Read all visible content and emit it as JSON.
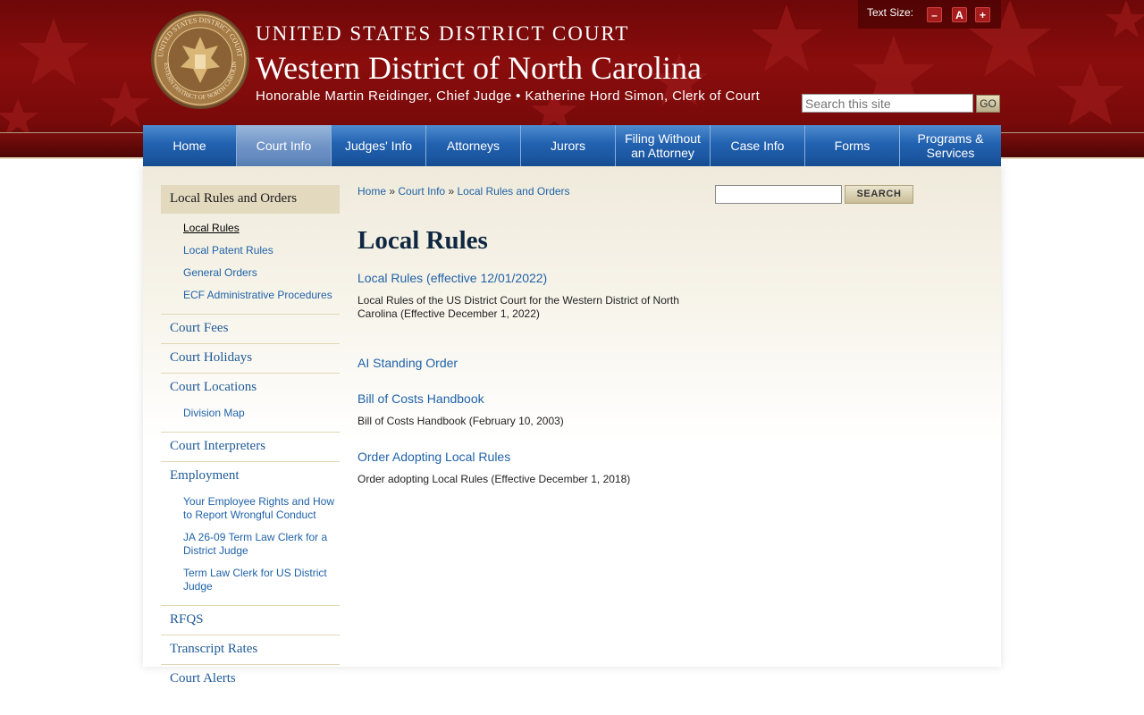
{
  "header": {
    "court_line": "UNITED STATES DISTRICT COURT",
    "district": "Western District of North Carolina",
    "officials": "Honorable Martin Reidinger, Chief Judge • Katherine Hord Simon, Clerk of Court",
    "text_size_label": "Text Size:",
    "text_size_buttons": [
      "–",
      "A",
      "+"
    ],
    "search_placeholder": "Search this site",
    "go_label": "GO"
  },
  "nav": {
    "items": [
      "Home",
      "Court Info",
      "Judges' Info",
      "Attorneys",
      "Jurors",
      "Filing Without an Attorney",
      "Case Info",
      "Forms",
      "Programs & Services"
    ],
    "active": "Court Info"
  },
  "sidebar": {
    "heading": "Local Rules and Orders",
    "heading_sub": [
      "Local Rules",
      "Local Patent Rules",
      "General Orders",
      "ECF Administrative Procedures"
    ],
    "items": [
      {
        "label": "Court Fees"
      },
      {
        "label": "Court Holidays"
      },
      {
        "label": "Court Locations",
        "sub": [
          "Division Map"
        ]
      },
      {
        "label": "Court Interpreters"
      },
      {
        "label": "Employment",
        "sub": [
          "Your Employee Rights and How to Report Wrongful Conduct",
          "JA 26-09 Term Law Clerk for a District Judge",
          "Term Law Clerk for US District Judge"
        ]
      },
      {
        "label": "RFQS"
      },
      {
        "label": "Transcript Rates"
      },
      {
        "label": "Court Alerts"
      }
    ]
  },
  "breadcrumb": {
    "home": "Home",
    "sep": "»",
    "section": "Court Info",
    "current": "Local Rules and Orders"
  },
  "search": {
    "button": "SEARCH"
  },
  "main": {
    "title": "Local Rules",
    "docs": [
      {
        "title": "Local Rules (effective 12/01/2022)",
        "desc": "Local Rules of the US District Court for the Western District of North Carolina (Effective December 1, 2022)"
      },
      {
        "title": "AI Standing Order",
        "desc": ""
      },
      {
        "title": "Bill of Costs Handbook",
        "desc": "Bill of Costs Handbook (February 10, 2003)"
      },
      {
        "title": "Order Adopting Local Rules",
        "desc": "Order adopting Local Rules (Effective December 1, 2018)"
      }
    ]
  },
  "colors": {
    "header_red": "#7a0a0a",
    "nav_blue": "#2262b0",
    "link_blue": "#1f62a8",
    "sidebar_tan": "#e3d9bf"
  }
}
